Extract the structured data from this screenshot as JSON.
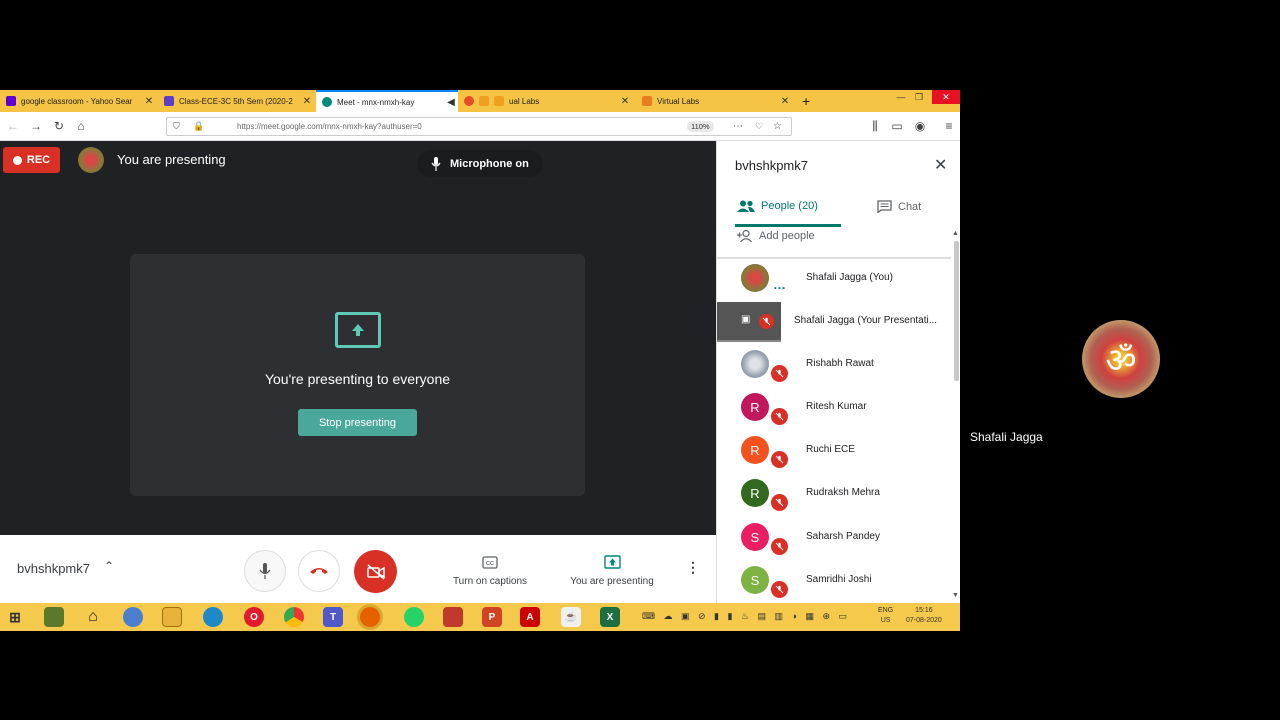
{
  "browser": {
    "tabs": [
      {
        "label": "google classroom - Yahoo Sear",
        "color": "#6001d2"
      },
      {
        "label": "Class-ECE-3C 5th Sem (2020-2",
        "color": "#5f3dc4"
      },
      {
        "label": "Meet - mnx-nmxh-kay",
        "color": "#00897b"
      },
      {
        "label": "ual Labs",
        "color": "#e67e22"
      },
      {
        "label": "Virtual Labs",
        "color": "#e67e22"
      }
    ],
    "new_tab": "+",
    "url": "https://meet.google.com/mnx-nmxh-kay?authuser=0",
    "zoom": "110%"
  },
  "meet": {
    "rec_label": "REC",
    "presenting_banner": "You are presenting",
    "mic_status": "Microphone on",
    "present_title": "You're presenting to everyone",
    "stop_button": "Stop presenting",
    "meeting_code": "bvhshkpmk7",
    "captions_label": "Turn on captions",
    "presenting_label": "You are presenting"
  },
  "panel": {
    "title": "bvhshkpmk7",
    "people_tab": "People (20)",
    "chat_tab": "Chat",
    "add_people": "Add people",
    "participants": [
      {
        "name": "Shafali Jagga (You)",
        "initial": "",
        "color": "#8a7a3a"
      },
      {
        "name": "Shafali Jagga (Your Presentati...",
        "initial": "",
        "color": "#555555"
      },
      {
        "name": "Rishabh Rawat",
        "initial": "",
        "color": "#9aa4b0"
      },
      {
        "name": "Ritesh Kumar",
        "initial": "R",
        "color": "#c2185b"
      },
      {
        "name": "Ruchi ECE",
        "initial": "R",
        "color": "#f4511e"
      },
      {
        "name": "Rudraksh Mehra",
        "initial": "R",
        "color": "#33691e"
      },
      {
        "name": "Saharsh Pandey",
        "initial": "S",
        "color": "#e91e63"
      },
      {
        "name": "Samridhi Joshi",
        "initial": "S",
        "color": "#7cb342"
      }
    ]
  },
  "taskbar": {
    "lang_1": "ENG",
    "lang_2": "US",
    "time": "15:16",
    "date": "07-08-2020"
  },
  "tile": {
    "name": "Shafali Jagga",
    "avatar_glyph": "ॐ"
  }
}
